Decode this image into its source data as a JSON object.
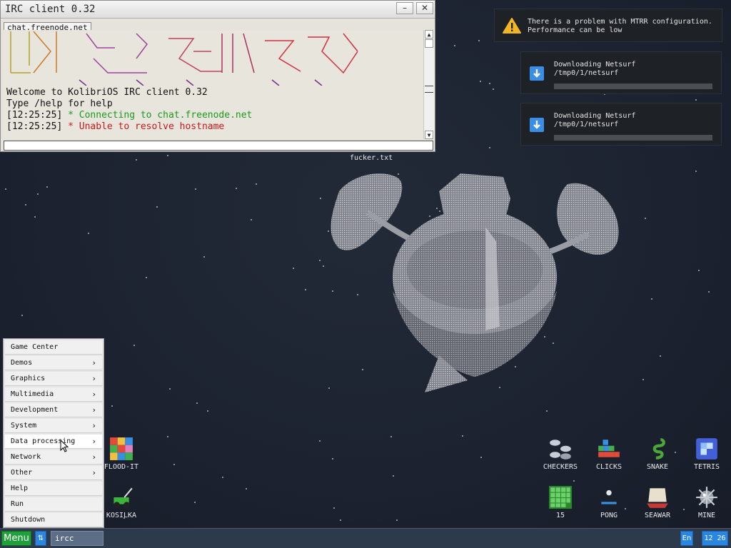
{
  "irc": {
    "title": "IRC client 0.32",
    "tab": "chat.freenode.net",
    "lines": [
      {
        "text": "Welcome to KolibriOS IRC client 0.32",
        "style": "normal"
      },
      {
        "text": "Type /help for help",
        "style": "normal"
      },
      {
        "time": "[12:25:25]",
        "text": " * Connecting to chat.freenode.net",
        "style": "green"
      },
      {
        "time": "[12:25:25]",
        "text": " * Unable to resolve hostname",
        "style": "red"
      }
    ],
    "input_value": ""
  },
  "notifications": [
    {
      "icon": "warning-icon",
      "line1": "There is a problem with MTRR configuration.",
      "line2": "Performance can be low"
    },
    {
      "icon": "download-icon",
      "line1": "Downloading Netsurf",
      "line2": "/tmp0/1/netsurf",
      "progress": 0
    },
    {
      "icon": "download-icon",
      "line1": "Downloading Netsurf",
      "line2": "/tmp0/1/netsurf",
      "progress": 0
    }
  ],
  "desktop": {
    "file_label": "fucker.txt",
    "icons": [
      {
        "name": "FLOOD-IT"
      },
      {
        "name": "KOSILKA"
      },
      {
        "name": "CHECKERS"
      },
      {
        "name": "CLICKS"
      },
      {
        "name": "SNAKE"
      },
      {
        "name": "TETRIS"
      },
      {
        "name": "15"
      },
      {
        "name": "PONG"
      },
      {
        "name": "SEAWAR"
      },
      {
        "name": "MINE"
      }
    ]
  },
  "menu": {
    "items": [
      {
        "label": "Game Center",
        "submenu": false
      },
      {
        "label": "Demos",
        "submenu": true
      },
      {
        "label": "Graphics",
        "submenu": true
      },
      {
        "label": "Multimedia",
        "submenu": true
      },
      {
        "label": "Development",
        "submenu": true
      },
      {
        "label": "System",
        "submenu": true
      },
      {
        "label": "Data processing",
        "submenu": true
      },
      {
        "label": "Network",
        "submenu": true
      },
      {
        "label": "Other",
        "submenu": true
      },
      {
        "label": "Help",
        "submenu": false
      },
      {
        "label": "Run",
        "submenu": false
      },
      {
        "label": "Shutdown",
        "submenu": false
      }
    ],
    "chevron": "›"
  },
  "taskbar": {
    "menu_label": "Menu",
    "switch_glyph": "⇅",
    "task_label": "ircc",
    "lang": "En",
    "clock": "12 26"
  },
  "colors": {
    "accent": "#2a86e0",
    "menu_button": "#1fa03a",
    "green_text": "#1a9a1a",
    "red_text": "#c81a1a"
  }
}
